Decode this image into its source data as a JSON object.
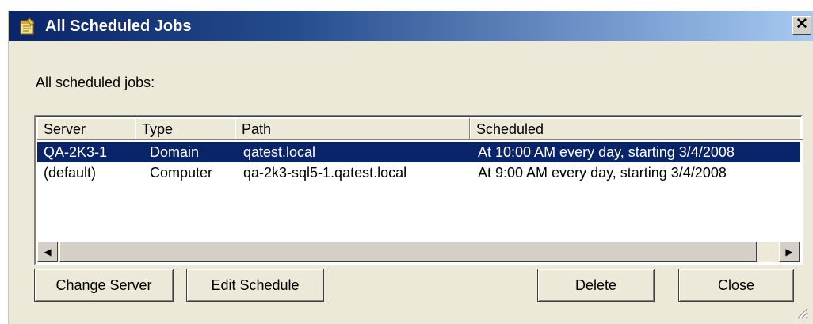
{
  "window": {
    "title": "All Scheduled Jobs",
    "close_glyph": "✕",
    "icon": "scheduled-task-icon"
  },
  "label": "All scheduled jobs:",
  "table": {
    "columns": [
      "Server",
      "Type",
      "Path",
      "Scheduled"
    ],
    "rows": [
      [
        "QA-2K3-1",
        "Domain",
        "qatest.local",
        "At 10:00 AM every day, starting 3/4/2008"
      ],
      [
        "(default)",
        "Computer",
        "qa-2k3-sql5-1.qatest.local",
        "At 9:00 AM every day, starting 3/4/2008"
      ]
    ],
    "selected_row": 0
  },
  "scrollbar": {
    "left_arrow": "◀",
    "right_arrow": "▶"
  },
  "buttons": {
    "change_server": "Change Server",
    "edit_schedule": "Edit Schedule",
    "delete": "Delete",
    "close": "Close"
  },
  "colors": {
    "title_gradient_start": "#0a246a",
    "title_gradient_end": "#a6caf0",
    "selection": "#0a246a",
    "dialog_bg": "#ece9d8"
  }
}
